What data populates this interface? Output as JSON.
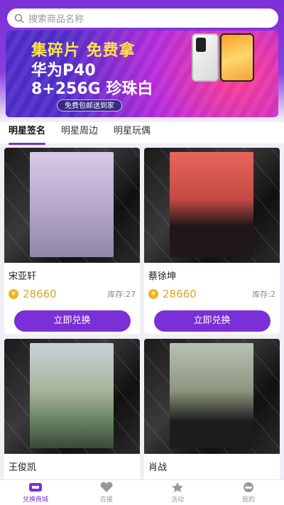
{
  "search": {
    "placeholder": "搜索商品名称"
  },
  "banner": {
    "line1": "集碎片 免费拿",
    "line2": "华为P40",
    "line3": "8+256G 珍珠白",
    "pill": "免费包邮送到家"
  },
  "tabs": [
    {
      "label": "明星签名",
      "active": true
    },
    {
      "label": "明星周边",
      "active": false
    },
    {
      "label": "明星玩偶",
      "active": false
    }
  ],
  "products": [
    {
      "name": "宋亚轩",
      "price": "28660",
      "stock": "库存:27",
      "button": "立即兑换"
    },
    {
      "name": "蔡徐坤",
      "price": "28660",
      "stock": "库存:2",
      "button": "立即兑换"
    },
    {
      "name": "王俊凯",
      "price": "",
      "stock": "",
      "button": ""
    },
    {
      "name": "肖战",
      "price": "",
      "stock": "",
      "button": ""
    }
  ],
  "nav": [
    {
      "label": "兑换商城",
      "icon": "store-icon",
      "active": true
    },
    {
      "label": "应援",
      "icon": "heart-icon",
      "active": false
    },
    {
      "label": "活动",
      "icon": "star-icon",
      "active": false
    },
    {
      "label": "我的",
      "icon": "profile-icon",
      "active": false
    }
  ],
  "colors": {
    "accent": "#7b2fd6",
    "coin": "#f3b31f",
    "price": "#d9a52f"
  }
}
